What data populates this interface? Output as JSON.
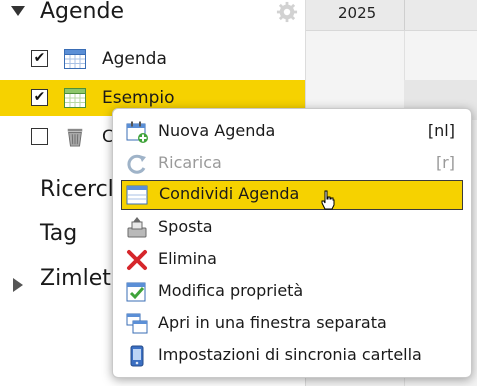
{
  "sidebar": {
    "section_title": "Agende",
    "items": [
      {
        "label": "Agenda",
        "checked": true,
        "icon": "calendar-icon"
      },
      {
        "label": "Esempio",
        "checked": true,
        "icon": "calendar-green-icon"
      },
      {
        "label": "C",
        "checked": false,
        "icon": "trash-icon"
      }
    ],
    "nav": {
      "search": "Ricercl",
      "tag": "Tag",
      "zimlet": "Zimlet"
    }
  },
  "calendar": {
    "year": "2025"
  },
  "context_menu": {
    "items": [
      {
        "label": "Nuova Agenda",
        "shortcut": "[nl]",
        "icon": "new-calendar-icon",
        "enabled": true
      },
      {
        "label": "Ricarica",
        "shortcut": "[r]",
        "icon": "reload-icon",
        "enabled": false
      },
      {
        "label": "Condividi Agenda",
        "shortcut": "",
        "icon": "share-calendar-icon",
        "enabled": true,
        "highlighted": true
      },
      {
        "label": "Sposta",
        "shortcut": "",
        "icon": "move-icon",
        "enabled": true
      },
      {
        "label": "Elimina",
        "shortcut": "",
        "icon": "delete-icon",
        "enabled": true
      },
      {
        "label": "Modifica proprietà",
        "shortcut": "",
        "icon": "properties-icon",
        "enabled": true
      },
      {
        "label": "Apri in una finestra separata",
        "shortcut": "",
        "icon": "new-window-icon",
        "enabled": true
      },
      {
        "label": "Impostazioni di sincronia cartella",
        "shortcut": "",
        "icon": "sync-settings-icon",
        "enabled": true
      }
    ]
  },
  "colors": {
    "highlight": "#f6d200",
    "disabled_text": "#9a9a9a"
  }
}
